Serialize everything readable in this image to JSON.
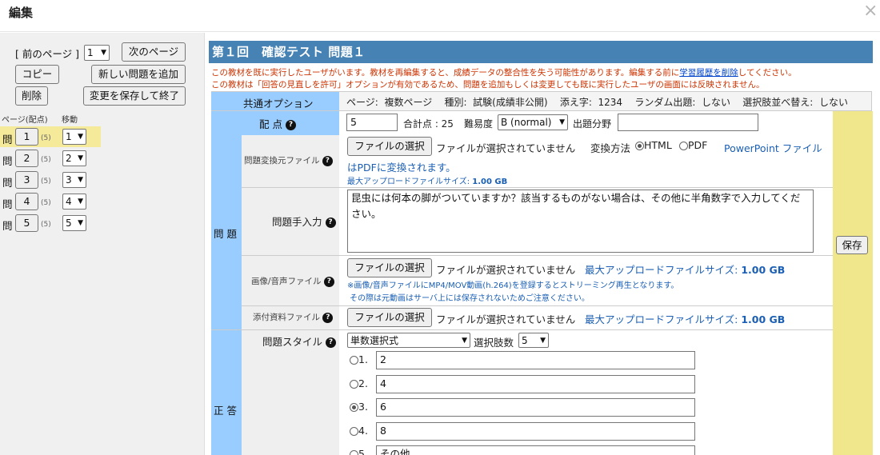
{
  "dialog": {
    "title": "編集",
    "close_icon": "×"
  },
  "left": {
    "prev_page": "[ 前のページ ]",
    "page_select": "1",
    "next_page": "次のページ",
    "copy": "コピー",
    "add_question": "新しい問題を追加",
    "delete": "削除",
    "save_exit": "変更を保存して終了",
    "col_page": "ページ(配点)",
    "col_move": "移動",
    "q_prefix": "問",
    "questions": [
      {
        "num": "1",
        "points": "(5)",
        "move": "1"
      },
      {
        "num": "2",
        "points": "(5)",
        "move": "2"
      },
      {
        "num": "3",
        "points": "(5)",
        "move": "3"
      },
      {
        "num": "4",
        "points": "(5)",
        "move": "4"
      },
      {
        "num": "5",
        "points": "(5)",
        "move": "5"
      }
    ]
  },
  "main": {
    "header": "第１回　確認テスト  問題１",
    "warn1_a": "この教材を既に実行したユーザがいます。教材を再編集すると、成績データの整合性を失う可能性があります。編集する前に",
    "warn1_link": "学習履歴を削除",
    "warn1_b": "してください。",
    "warn2": "この教材は「回答の見直しを許可」オプションが有効であるため、問題を追加もしくは変更しても既に実行したユーザの画面には反映されません。",
    "common": {
      "label": "共通オプション",
      "page_label": "ページ:",
      "page_value": "複数ページ",
      "type_label": "種別:",
      "type_value": "試験(成績非公開)",
      "suffix_label": "添え字:",
      "suffix_value": "1234",
      "random_label": "ランダム出題:",
      "random_value": "しない",
      "shuffle_label": "選択肢並べ替え:",
      "shuffle_value": "しない"
    },
    "points": {
      "label": "配 点",
      "value": "5",
      "total_label": "合計点 : 25",
      "difficulty_label": "難易度",
      "difficulty_value": "B (normal)",
      "field_label": "出題分野",
      "field_value": ""
    },
    "question_label": "問 題",
    "convert": {
      "label": "問題変換元ファイル",
      "choose": "ファイルの選択",
      "none": "ファイルが選択されていません",
      "method_label": "変換方法",
      "html": "HTML",
      "pdf": "PDF",
      "note_a": "PowerPoint ファイル",
      "note_b": "はPDFに変換されます。",
      "max_label": "最大アップロードファイルサイズ:",
      "max_value": "1.00 GB"
    },
    "manual": {
      "label": "問題手入力",
      "text": "昆虫には何本の脚がついていますか？該当するものがない場合は、その他に半角数字で入力してください。"
    },
    "media": {
      "label": "画像/音声ファイル",
      "choose": "ファイルの選択",
      "none": "ファイルが選択されていません",
      "max_label": "最大アップロードファイルサイズ:",
      "max_value": "1.00 GB",
      "note1": "※画像/音声ファイルにMP4/MOV動画(h.264)を登録するとストリーミング再生となります。",
      "note2": "その際は元動画はサーバ上には保存されないためご注意ください。"
    },
    "attach": {
      "label": "添付資料ファイル",
      "choose": "ファイルの選択",
      "none": "ファイルが選択されていません",
      "max_label": "最大アップロードファイルサイズ:",
      "max_value": "1.00 GB"
    },
    "save": "保存",
    "answer_label": "正 答",
    "style": {
      "label": "問題スタイル",
      "value": "単数選択式",
      "choices_label": "選択肢数",
      "choices_value": "5"
    },
    "options": [
      {
        "label": "1.",
        "value": "2",
        "selected": false
      },
      {
        "label": "2.",
        "value": "4",
        "selected": false
      },
      {
        "label": "3.",
        "value": "6",
        "selected": true
      },
      {
        "label": "4.",
        "value": "8",
        "selected": false
      },
      {
        "label": "5.",
        "value": "その他",
        "selected": false
      }
    ]
  }
}
